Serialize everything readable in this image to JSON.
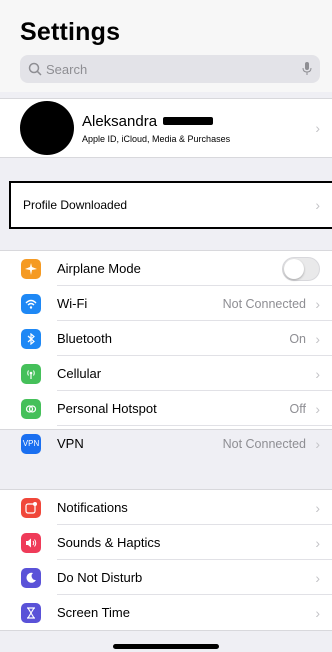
{
  "header": {
    "title": "Settings"
  },
  "search": {
    "placeholder": "Search",
    "icon": "search-icon",
    "mic_icon": "mic-icon"
  },
  "profile": {
    "name": "Aleksandra",
    "subtitle": "Apple ID, iCloud, Media & Purchases"
  },
  "profile_downloaded": {
    "label": "Profile Downloaded"
  },
  "group1": [
    {
      "label": "Airplane Mode",
      "icon": "airplane-icon",
      "color": "#f59a23",
      "value": "",
      "toggle": true
    },
    {
      "label": "Wi-Fi",
      "icon": "wifi-icon",
      "color": "#1e88f5",
      "value": "Not Connected"
    },
    {
      "label": "Bluetooth",
      "icon": "bluetooth-icon",
      "color": "#1e88f5",
      "value": "On"
    },
    {
      "label": "Cellular",
      "icon": "cellular-icon",
      "color": "#45c05a",
      "value": ""
    },
    {
      "label": "Personal Hotspot",
      "icon": "hotspot-icon",
      "color": "#45c05a",
      "value": "Off"
    },
    {
      "label": "VPN",
      "icon": "vpn-icon",
      "color": "#1a6ff0",
      "value": "Not Connected"
    }
  ],
  "group2": [
    {
      "label": "Notifications",
      "icon": "notifications-icon",
      "color": "#f0473a"
    },
    {
      "label": "Sounds & Haptics",
      "icon": "sounds-icon",
      "color": "#ef3b59"
    },
    {
      "label": "Do Not Disturb",
      "icon": "moon-icon",
      "color": "#5a52d8"
    },
    {
      "label": "Screen Time",
      "icon": "hourglass-icon",
      "color": "#5a52d8"
    }
  ],
  "vpn_badge": "VPN"
}
